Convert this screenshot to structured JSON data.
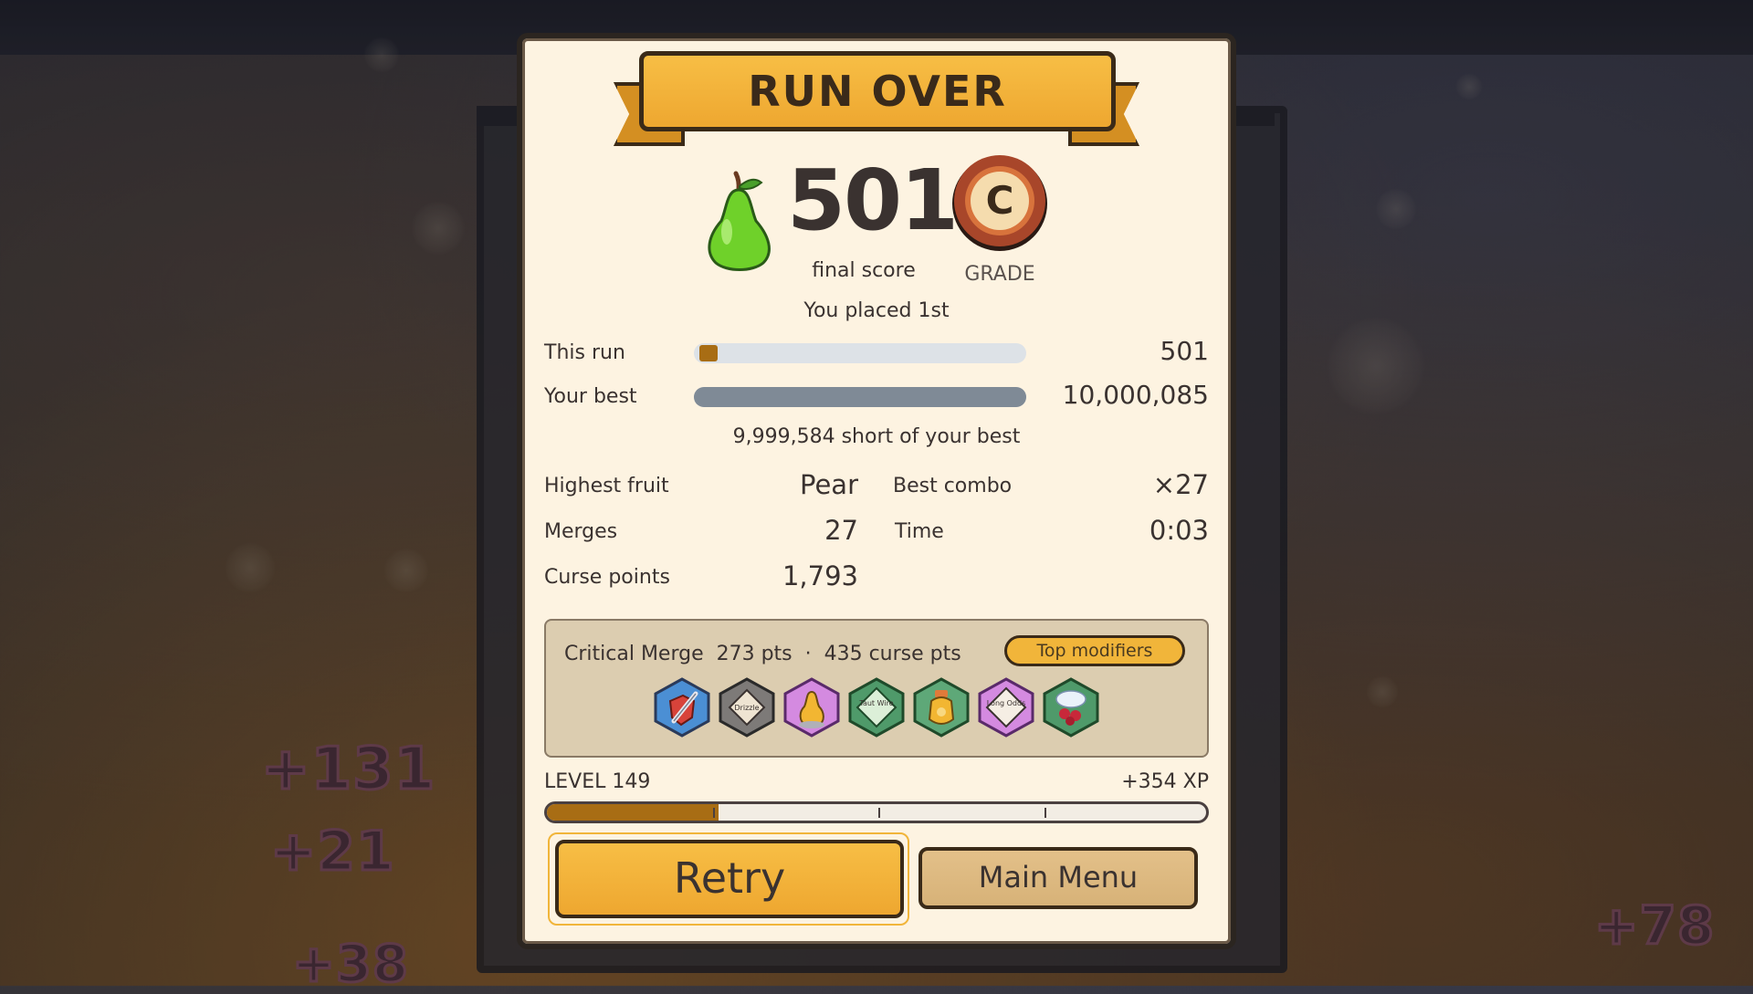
{
  "title": "RUN OVER",
  "score": {
    "value": "501",
    "label": "final score",
    "grade": "C",
    "grade_label": "GRADE",
    "placement": "You placed 1st"
  },
  "comparison": {
    "this_run": {
      "label": "This run",
      "value": "501",
      "fraction": 5e-05
    },
    "your_best": {
      "label": "Your best",
      "value": "10,000,085",
      "fraction": 1.0
    },
    "short_text": "9,999,584 short of your best"
  },
  "stats": {
    "highest_fruit": {
      "label": "Highest fruit",
      "value": "Pear"
    },
    "best_combo": {
      "label": "Best combo",
      "value": "×27"
    },
    "merges": {
      "label": "Merges",
      "value": "27"
    },
    "time": {
      "label": "Time",
      "value": "0:03"
    },
    "curse_points": {
      "label": "Curse points",
      "value": "1,793"
    }
  },
  "modifiers": {
    "summary": "Critical Merge  273 pts  ·  435 curse pts",
    "top_button": "Top modifiers",
    "icons": [
      {
        "name": "sword-shield-icon",
        "label": ""
      },
      {
        "name": "drizzle-icon",
        "label": "Drizzle"
      },
      {
        "name": "golden-pear-icon",
        "label": ""
      },
      {
        "name": "taut-wire-icon",
        "label": "Taut Wire"
      },
      {
        "name": "honey-jar-icon",
        "label": ""
      },
      {
        "name": "long-odds-icon",
        "label": "Long Odds"
      },
      {
        "name": "cherry-cloud-icon",
        "label": ""
      }
    ]
  },
  "level": {
    "label": "LEVEL 149",
    "xp_gain": "+354 XP",
    "progress": 0.26
  },
  "buttons": {
    "retry": "Retry",
    "main_menu": "Main Menu"
  },
  "floating_points": [
    "+131",
    "+21",
    "+38",
    "+78"
  ],
  "colors": {
    "panel": "#fdf3e1",
    "banner": "#f1b53a",
    "accent_fill": "#a86d14",
    "best_bar": "#7f8a96"
  }
}
